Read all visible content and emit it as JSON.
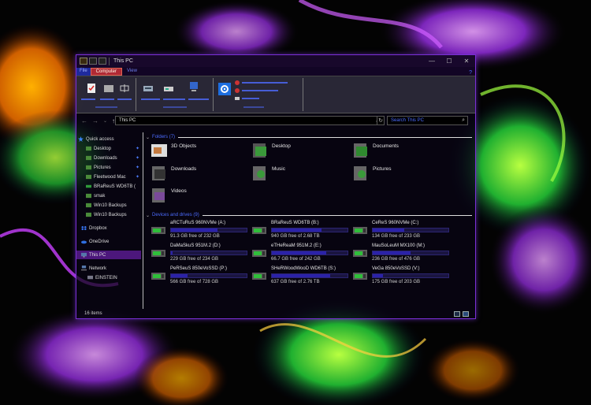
{
  "window": {
    "title": "This PC",
    "minimize_glyph": "—",
    "maximize_glyph": "☐",
    "close_glyph": "✕",
    "help_glyph": "?"
  },
  "ribbon": {
    "tabs": [
      {
        "label": "File"
      },
      {
        "label": "Computer"
      },
      {
        "label": "View"
      }
    ]
  },
  "address": {
    "path": "This PC",
    "back_glyph": "←",
    "forward_glyph": "→",
    "recent_glyph": "⌄",
    "up_glyph": "↑",
    "refresh_glyph": "↻",
    "search_placeholder": "Search This PC"
  },
  "nav": {
    "items": [
      {
        "label": "Quick access",
        "pinned": false
      },
      {
        "label": "Desktop",
        "pinned": true
      },
      {
        "label": "Downloads",
        "pinned": true
      },
      {
        "label": "Pictures",
        "pinned": true
      },
      {
        "label": "Fleetwood Mac",
        "pinned": true
      },
      {
        "label": "BRaReuS   WD6TB (",
        "pinned": false
      },
      {
        "label": "smak",
        "pinned": false
      },
      {
        "label": "Win10 Backups",
        "pinned": false
      },
      {
        "label": "Win10 Backups",
        "pinned": false
      },
      {
        "label": "Dropbox",
        "pinned": false
      },
      {
        "label": "OneDrive",
        "pinned": false
      },
      {
        "label": "This PC",
        "pinned": false
      },
      {
        "label": "Network",
        "pinned": false
      },
      {
        "label": "EINSTEIN",
        "pinned": false
      }
    ]
  },
  "content": {
    "folders_header": "Folders (7)",
    "drives_header": "Devices and drives (9)",
    "folders": [
      {
        "label": "3D Objects"
      },
      {
        "label": "Desktop"
      },
      {
        "label": "Documents"
      },
      {
        "label": "Downloads"
      },
      {
        "label": "Music"
      },
      {
        "label": "Pictures"
      },
      {
        "label": "Videos"
      }
    ],
    "drives": [
      {
        "name": "aRCTuRuS   960NVMe (A:)",
        "free": "91.3 GB free of 232 GB",
        "used_fraction": 0.61
      },
      {
        "name": "BRaReuS   WD6TB (B:)",
        "free": "940 GB free of 2.68 TB",
        "used_fraction": 0.66
      },
      {
        "name": "CeReS   960NVMe (C:)",
        "free": "134 GB free of 233 GB",
        "used_fraction": 0.42
      },
      {
        "name": "DaMaSkuS   951M.2 (D:)",
        "free": "229 GB free of 234 GB",
        "used_fraction": 0.02
      },
      {
        "name": "eTHeReaM   951M.2 (E:)",
        "free": "66.7 GB free of 242 GB",
        "used_fraction": 0.72
      },
      {
        "name": "MauSoLeuM  MX100 (M:)",
        "free": "236 GB free of 476 GB",
        "used_fraction": 0.5
      },
      {
        "name": "PeRSeuS   850eVoSSD (P:)",
        "free": "566 GB free of 728 GB",
        "used_fraction": 0.22
      },
      {
        "name": "SHeRWoodWooD WD6TB (S:)",
        "free": "637 GB free of 2.76 TB",
        "used_fraction": 0.77
      },
      {
        "name": "VeGa   850eVoSSD (V:)",
        "free": "175 GB free of 203 GB",
        "used_fraction": 0.14
      }
    ]
  },
  "status": {
    "items_count": "16 items"
  },
  "colors": {
    "accent": "#7a2fd6",
    "link_blue": "#4c6cff",
    "selected_bg": "#6a1ea8",
    "drive_fill": "#2b22a8"
  }
}
